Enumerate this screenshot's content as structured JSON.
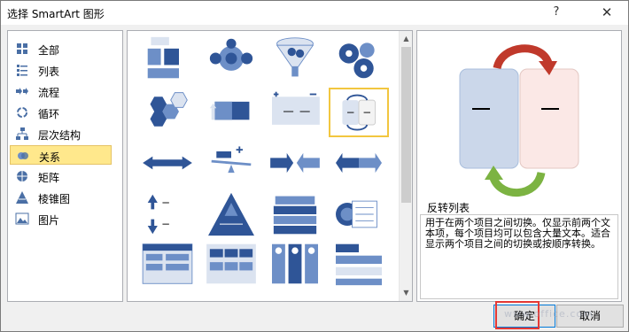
{
  "window": {
    "title": "选择 SmartArt 图形",
    "help": "?",
    "close": "✕"
  },
  "categories": [
    {
      "label": "全部",
      "icon": "all-icon"
    },
    {
      "label": "列表",
      "icon": "list-icon"
    },
    {
      "label": "流程",
      "icon": "process-icon"
    },
    {
      "label": "循环",
      "icon": "cycle-icon"
    },
    {
      "label": "层次结构",
      "icon": "hierarchy-icon"
    },
    {
      "label": "关系",
      "icon": "relationship-icon",
      "selected": true
    },
    {
      "label": "矩阵",
      "icon": "matrix-icon"
    },
    {
      "label": "棱锥图",
      "icon": "pyramid-icon"
    },
    {
      "label": "图片",
      "icon": "picture-icon"
    }
  ],
  "gallery": {
    "selected_index": 7,
    "thumbnails": [
      "equation-icon",
      "radial-venn-icon",
      "funnel-icon",
      "gears-icon",
      "hexagon-cluster-icon",
      "counterbalance-arrows-icon",
      "plus-minus-icon",
      "opposing-toggle-icon",
      "opposing-arrows-icon",
      "balance-icon",
      "converging-arrows-icon",
      "diverging-arrows-icon",
      "arrow-list-icon",
      "triangle-pyramid-icon",
      "stacked-table-icon",
      "nested-target-icon",
      "table-list-icon",
      "grid-tabs-icon",
      "segmented-columns-icon",
      "hierarchy-tabs-icon"
    ]
  },
  "preview": {
    "name": "反转列表",
    "description": "用于在两个项目之间切换。仅显示前两个文本项，每个项目均可以包含大量文本。适合显示两个项目之间的切换或按顺序转换。",
    "placeholder": "—"
  },
  "buttons": {
    "ok": "确定",
    "cancel": "取消"
  },
  "watermark": "www.office.com",
  "colors": {
    "accent": "#2f5597",
    "selected_bg": "#ffe88c",
    "highlight_red": "#e53935",
    "preview_left": "#cbd7ea",
    "preview_right": "#fbe8e6",
    "arrow_red": "#c0392b",
    "arrow_green": "#7cb342"
  }
}
